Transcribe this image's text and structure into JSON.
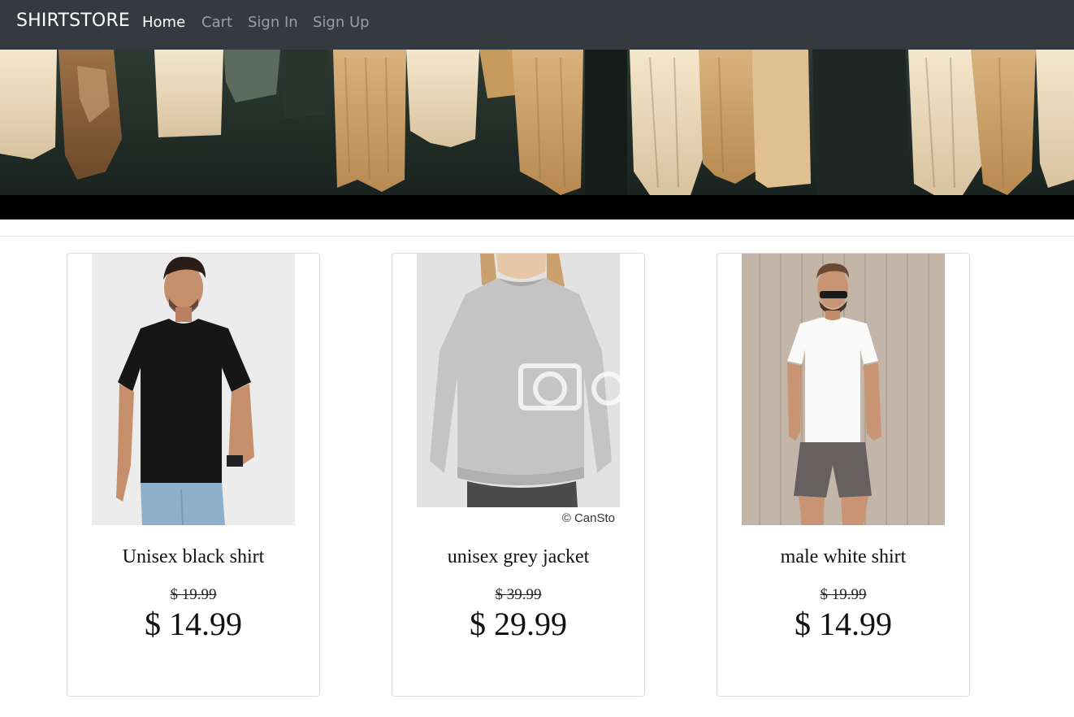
{
  "navbar": {
    "brand": "SHIRTSTORE",
    "links": [
      {
        "label": "Home",
        "active": true
      },
      {
        "label": "Cart",
        "active": false
      },
      {
        "label": "Sign In",
        "active": false
      },
      {
        "label": "Sign Up",
        "active": false
      }
    ]
  },
  "banner": {
    "image": "clothes-rack-photo"
  },
  "products": [
    {
      "name": "Unisex black shirt",
      "old_price": "$ 19.99",
      "price": "$ 14.99",
      "image": "man-black-tshirt-photo"
    },
    {
      "name": "unisex grey jacket",
      "old_price": "$ 39.99",
      "price": "$ 29.99",
      "image": "grey-sweatshirt-photo",
      "watermark": "© CanSto"
    },
    {
      "name": "male white shirt",
      "old_price": "$ 19.99",
      "price": "$ 14.99",
      "image": "man-white-tshirt-photo"
    }
  ],
  "colors": {
    "navbar_bg": "#343a40",
    "nav_active": "#ffffff",
    "nav_inactive": "rgba(255,255,255,0.5)"
  }
}
